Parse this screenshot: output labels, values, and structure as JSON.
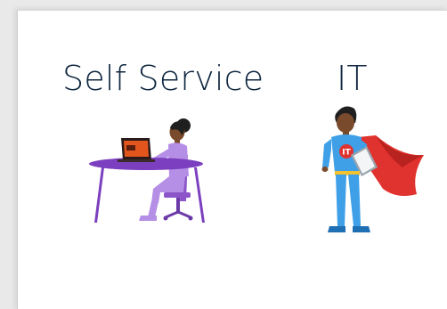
{
  "options": [
    {
      "id": "self-service",
      "label": "Self Service",
      "icon": "person-at-laptop-desk-illustration"
    },
    {
      "id": "it",
      "label": "IT",
      "icon": "it-superhero-with-laptop-illustration"
    }
  ],
  "colors": {
    "background": "#e9e9e9",
    "card": "#ffffff",
    "label_text": "#0f2740",
    "desk_purple": "#7b3fbf",
    "chair_purple": "#8b55c9",
    "clothing_lavender": "#b58ee6",
    "laptop_orange": "#e2561e",
    "hero_blue": "#3fa0e8",
    "cape_red": "#e0322e",
    "belt_yellow": "#f2c230",
    "skin_dark": "#7a4a2c",
    "hair_black": "#1f1f1f"
  }
}
